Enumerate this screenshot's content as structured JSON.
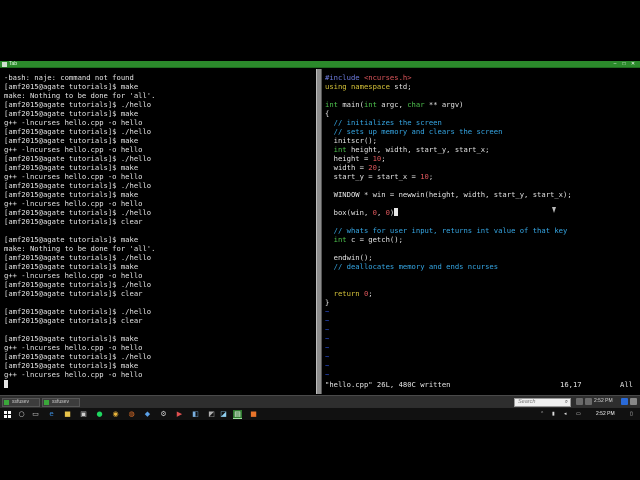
{
  "window": {
    "title": "Tab",
    "min_glyph": "–",
    "max_glyph": "□",
    "close_glyph": "✕",
    "accent": "#2b8a2b"
  },
  "terminal": {
    "lines": [
      "-bash: naje: command not found",
      "[amf2015@agate tutorials]$ make",
      "make: Nothing to be done for 'all'.",
      "[amf2015@agate tutorials]$ ./hello",
      "[amf2015@agate tutorials]$ make",
      "g++ -lncurses hello.cpp -o hello",
      "[amf2015@agate tutorials]$ ./hello",
      "[amf2015@agate tutorials]$ make",
      "g++ -lncurses hello.cpp -o hello",
      "[amf2015@agate tutorials]$ ./hello",
      "[amf2015@agate tutorials]$ make",
      "g++ -lncurses hello.cpp -o hello",
      "[amf2015@agate tutorials]$ ./hello",
      "[amf2015@agate tutorials]$ make",
      "g++ -lncurses hello.cpp -o hello",
      "[amf2015@agate tutorials]$ ./hello",
      "[amf2015@agate tutorials]$ clear",
      "",
      "[amf2015@agate tutorials]$ make",
      "make: Nothing to be done for 'all'.",
      "[amf2015@agate tutorials]$ ./hello",
      "[amf2015@agate tutorials]$ make",
      "g++ -lncurses hello.cpp -o hello",
      "[amf2015@agate tutorials]$ ./hello",
      "[amf2015@agate tutorials]$ clear",
      "",
      "[amf2015@agate tutorials]$ ./hello",
      "[amf2015@agate tutorials]$ clear",
      "",
      "[amf2015@agate tutorials]$ make",
      "g++ -lncurses hello.cpp -o hello",
      "[amf2015@agate tutorials]$ ./hello",
      "[amf2015@agate tutorials]$ make",
      "g++ -lncurses hello.cpp -o hello"
    ]
  },
  "editor": {
    "code": [
      [
        [
          "#include ",
          "pre"
        ],
        [
          "<ncurses.h>",
          "str"
        ]
      ],
      [
        [
          "using ",
          "kw"
        ],
        [
          "namespace ",
          "kw"
        ],
        [
          "std;",
          "plain"
        ]
      ],
      [],
      [
        [
          "int ",
          "type"
        ],
        [
          "main(",
          "plain"
        ],
        [
          "int ",
          "type"
        ],
        [
          "argc, ",
          "plain"
        ],
        [
          "char ",
          "type"
        ],
        [
          "** argv)",
          "plain"
        ]
      ],
      [
        [
          "{",
          "plain"
        ]
      ],
      [
        [
          "  // initializes the screen",
          "com"
        ]
      ],
      [
        [
          "  // sets up memory and clears the screen",
          "com"
        ]
      ],
      [
        [
          "  initscr();",
          "plain"
        ]
      ],
      [
        [
          "  int ",
          "type"
        ],
        [
          "height, width, start_y, start_x;",
          "plain"
        ]
      ],
      [
        [
          "  height = ",
          "plain"
        ],
        [
          "10",
          "num"
        ],
        [
          ";",
          "plain"
        ]
      ],
      [
        [
          "  width = ",
          "plain"
        ],
        [
          "20",
          "num"
        ],
        [
          ";",
          "plain"
        ]
      ],
      [
        [
          "  start_y = start_x = ",
          "plain"
        ],
        [
          "10",
          "num"
        ],
        [
          ";",
          "plain"
        ]
      ],
      [],
      [
        [
          "  WINDOW * win = newwin(height, width, start_y, start_x);",
          "plain"
        ]
      ],
      [],
      [
        [
          "  box(win, ",
          "plain"
        ],
        [
          "0",
          "num"
        ],
        [
          ", ",
          "plain"
        ],
        [
          "0",
          "num"
        ],
        [
          ")",
          "plain"
        ],
        [
          "",
          "cursor"
        ]
      ],
      [],
      [
        [
          "  // whats for user input, returns int value of that key",
          "com"
        ]
      ],
      [
        [
          "  int ",
          "type"
        ],
        [
          "c = getch();",
          "plain"
        ]
      ],
      [],
      [
        [
          "  endwin();",
          "plain"
        ]
      ],
      [
        [
          "  // deallocates memory and ends ncurses",
          "com"
        ]
      ],
      [],
      [],
      [
        [
          "  return ",
          "kw"
        ],
        [
          "0",
          "num"
        ],
        [
          ";",
          "plain"
        ]
      ],
      [
        [
          "}",
          "plain"
        ]
      ]
    ],
    "tilde": "~",
    "tilde_count": 8,
    "status_file": "\"hello.cpp\" 26L, 480C written",
    "status_pos": "16,17",
    "status_scroll": "All"
  },
  "taskbar_tabs": [
    "ssfusev",
    "ssfusev"
  ],
  "search": {
    "placeholder": "Search",
    "glyph": "⌕"
  },
  "clock": {
    "time": "2:52 PM"
  },
  "taskbar_icons": [
    "start-icon",
    "search-icon",
    "task-view-icon",
    "edge-icon",
    "file-explorer-icon",
    "store-icon",
    "spotify-icon",
    "chrome-icon",
    "firefox-icon",
    "settings-icon",
    "media-icon",
    "terminal-icon",
    "app-icon"
  ],
  "colors": {
    "comment": "#36a8e6",
    "keyword": "#d8c53a",
    "type": "#4ec24e",
    "string": "#e0575c",
    "preprocessor": "#6e7ce0",
    "tilde": "#2a4fd8"
  }
}
